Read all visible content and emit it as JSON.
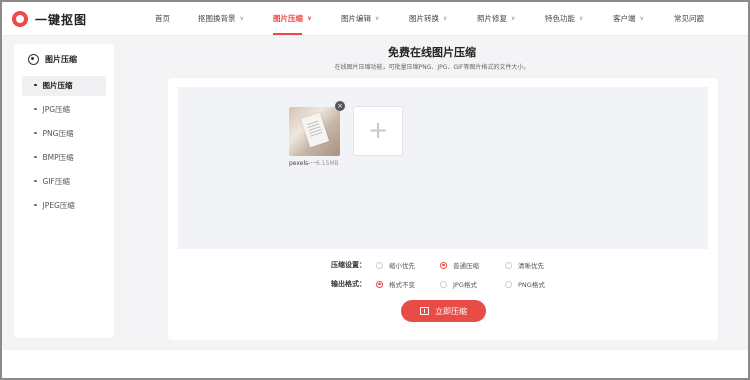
{
  "brand": {
    "name": "一键抠图",
    "color": "#e94b47"
  },
  "nav": [
    {
      "label": "首页",
      "dropdown": false
    },
    {
      "label": "抠图换背景",
      "dropdown": true
    },
    {
      "label": "图片压缩",
      "dropdown": true,
      "active": true
    },
    {
      "label": "图片编辑",
      "dropdown": true
    },
    {
      "label": "图片转换",
      "dropdown": true
    },
    {
      "label": "照片修复",
      "dropdown": true
    },
    {
      "label": "特色功能",
      "dropdown": true
    },
    {
      "label": "客户端",
      "dropdown": true
    },
    {
      "label": "常见问题",
      "dropdown": false
    }
  ],
  "sidebar": {
    "title": "图片压缩",
    "items": [
      {
        "label": "图片压缩",
        "active": true
      },
      {
        "label": "JPG压缩"
      },
      {
        "label": "PNG压缩"
      },
      {
        "label": "BMP压缩"
      },
      {
        "label": "GIF压缩"
      },
      {
        "label": "JPEG压缩"
      }
    ]
  },
  "main": {
    "title": "免费在线图片压缩",
    "subtitle": "在线图片压缩功能，可批量压缩PNG、JPG、GIF等图片格式的文件大小。",
    "file": {
      "name": "pexels-···",
      "size": "6.15MB"
    },
    "add_symbol": "+",
    "compress_setting": {
      "label": "压缩设置：",
      "options": [
        "缩小优先",
        "普通压缩",
        "清晰优先"
      ],
      "selected": 1
    },
    "output_format": {
      "label": "输出格式：",
      "options": [
        "格式不变",
        "JPG格式",
        "PNG格式"
      ],
      "selected": 0
    },
    "button_label": "立即压缩"
  }
}
